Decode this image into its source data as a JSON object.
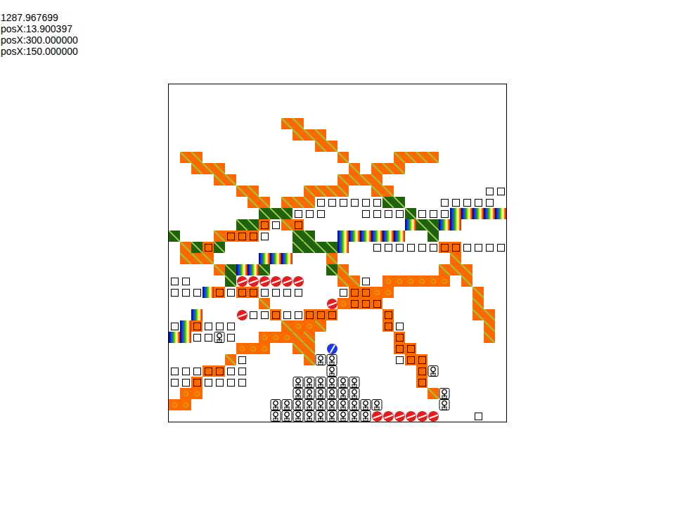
{
  "hud": {
    "lines": [
      "1287.967699",
      "posX:13.900397",
      "posX:300.000000",
      "posX:150.000000"
    ]
  },
  "map": {
    "rows": [
      "",
      "",
      "",
      "..........oo",
      "...........ooo",
      ".............oo",
      ".oo............o....oooo",
      "..ooo...........o.ooo",
      "....oo.........oooo",
      "......oo....oooo..oo........ww",
      ".......oo.ooowwwwwwgg...wwwww",
      "........gggwww...wwwwgwwwrrrrr",
      "......ggbwob.........rggrr",
      "g...obbbw..gg..rrrrrr..g",
      ".ogbg......ggggr..wwwwwwbbwwww",
      ".ooo....rrr...o..........o",
      "....ogrrg.....go........ooo",
      "ww...geeeeee...oow.cccccc.o",
      "wwwrbwbbwwww...wbbcc.......o",
      "........o.....ecbbb........o",
      "..r...ewwbwwbbb....b.......oo",
      "wrbwww....occo.....bw.......o",
      "rrwwkw..cccoo.......b.......o",
      "......ccc..oo.p.....bb",
      ".....ow.....okk.....wbb",
      "wwwbbww.......k.......bk",
      "wwbwwww....kkkkkk.....b",
      ".cc........kkkkkk......ok",
      "cc.......kkkkkkkkkk.....k",
      ".........kkkkkkkkkeeeeee...w"
    ]
  }
}
